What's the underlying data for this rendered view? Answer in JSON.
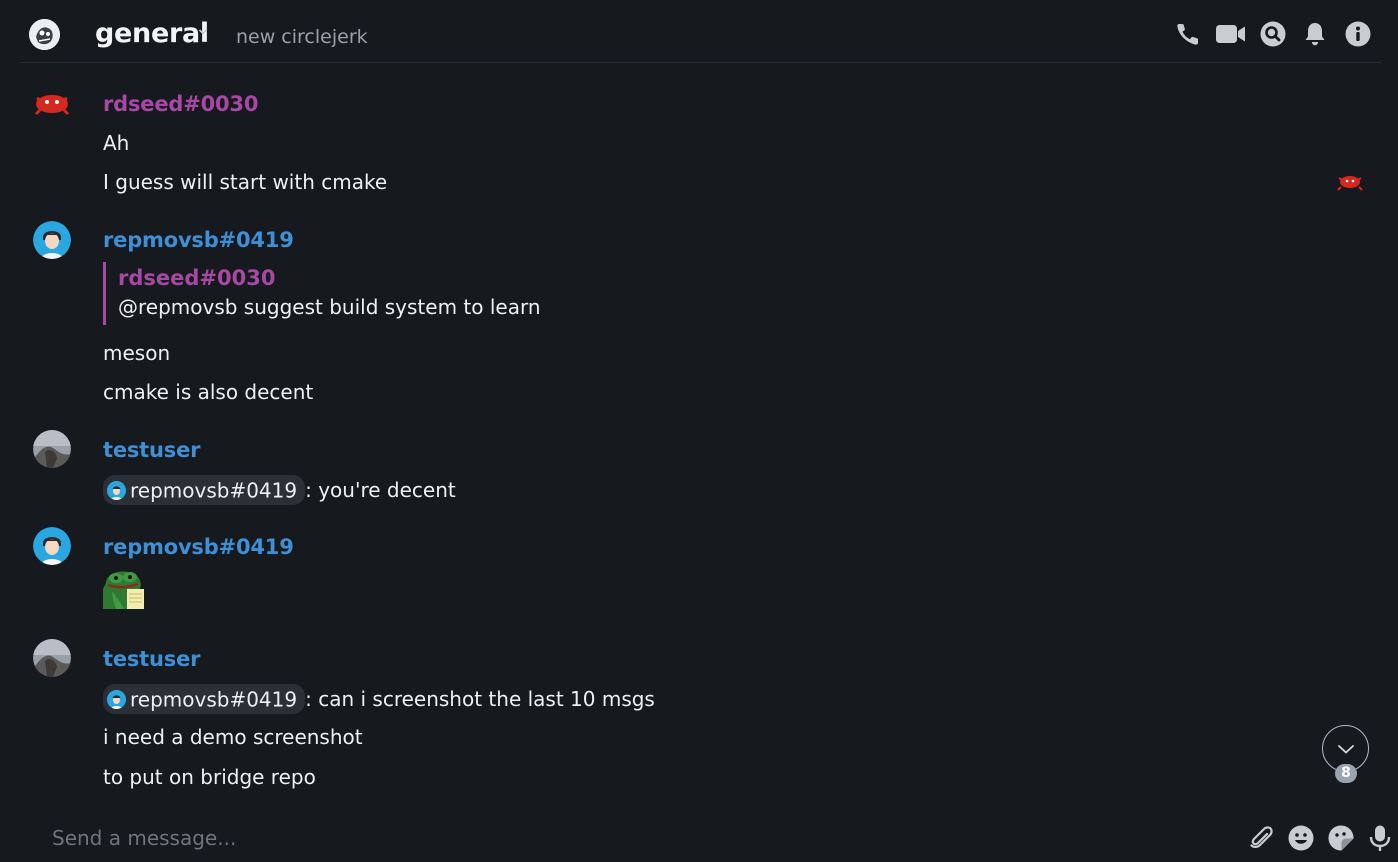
{
  "header": {
    "room_name": "general",
    "room_topic": "new circlejerk",
    "icons": [
      "phone-icon",
      "video-icon",
      "search-icon",
      "bell-icon",
      "info-icon"
    ]
  },
  "messages": [
    {
      "sender": "rdseed#0030",
      "lines": [
        "Ah",
        "I guess will start with cmake"
      ]
    },
    {
      "sender": "repmovsb#0419",
      "reply": {
        "sender": "rdseed#0030",
        "text": "@repmovsb suggest build system to learn"
      },
      "lines": [
        "meson",
        "cmake is also decent"
      ]
    },
    {
      "sender": "testuser",
      "mention": "repmovsb#0419",
      "lines": [
        ": you're decent"
      ]
    },
    {
      "sender": "repmovsb#0419",
      "sticker": "frog-sticker"
    },
    {
      "sender": "testuser",
      "mention": "repmovsb#0419",
      "lines": [
        ": can i screenshot the last 10 msgs",
        "i need a demo screenshot",
        "to put on bridge repo"
      ]
    }
  ],
  "jump_to_bottom": {
    "unread_count": "8"
  },
  "composer": {
    "placeholder": "Send a message...",
    "value": ""
  },
  "colors": {
    "background": "#16191e",
    "user_rdseed": "#a748a4",
    "user_blue": "#3f8fd6",
    "text": "#eef0f2"
  }
}
